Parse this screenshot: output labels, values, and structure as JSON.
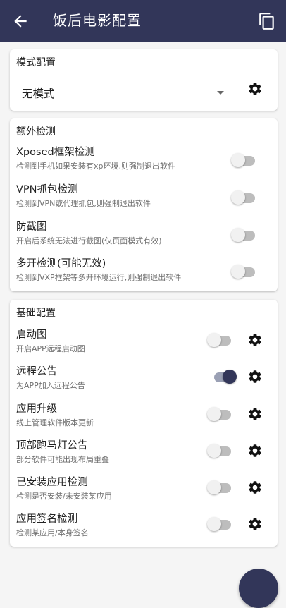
{
  "colors": {
    "primary": "#323659",
    "background": "#f5f5f5",
    "card": "#ffffff",
    "switch_off_track": "#bdbdbd",
    "switch_on_track": "#9aa0b4"
  },
  "appbar": {
    "title": "饭后电影配置",
    "back_icon": "arrow-left-icon",
    "copy_icon": "copy-icon"
  },
  "mode_card": {
    "title": "模式配置",
    "selected": "无模式",
    "dropdown_icon": "caret-down-icon",
    "settings_icon": "gear-icon"
  },
  "extra_card": {
    "title": "额外检测",
    "items": [
      {
        "label": "Xposed框架检测",
        "desc": "检测到手机如果安装有xp环境,则强制退出软件",
        "enabled": false
      },
      {
        "label": "VPN抓包检测",
        "desc": "检测到VPN或代理抓包,则强制退出软件",
        "enabled": false
      },
      {
        "label": "防截图",
        "desc": "开启后系统无法进行截图(仅页面模式有效)",
        "enabled": false
      },
      {
        "label": "多开检测(可能无效)",
        "desc": "检测到VXP框架等多开环境运行,则强制退出软件",
        "enabled": false
      }
    ]
  },
  "basic_card": {
    "title": "基础配置",
    "items": [
      {
        "label": "启动图",
        "desc": "开启APP远程启动图",
        "enabled": false,
        "icon": "gear-icon"
      },
      {
        "label": "远程公告",
        "desc": "为APP加入远程公告",
        "enabled": true,
        "icon": "gear-icon"
      },
      {
        "label": "应用升级",
        "desc": "线上管理软件版本更新",
        "enabled": false,
        "icon": "gear-icon"
      },
      {
        "label": "顶部跑马灯公告",
        "desc": "部分软件可能出现布局重叠",
        "enabled": false,
        "icon": "gear-icon"
      },
      {
        "label": "已安装应用检测",
        "desc": "检测是否安装/未安装某应用",
        "enabled": false,
        "icon": "gear-icon"
      },
      {
        "label": "应用签名检测",
        "desc": "检测某应用/本身签名",
        "enabled": false,
        "icon": "gear-icon"
      }
    ]
  },
  "fab": {
    "icon": "fab-icon"
  }
}
